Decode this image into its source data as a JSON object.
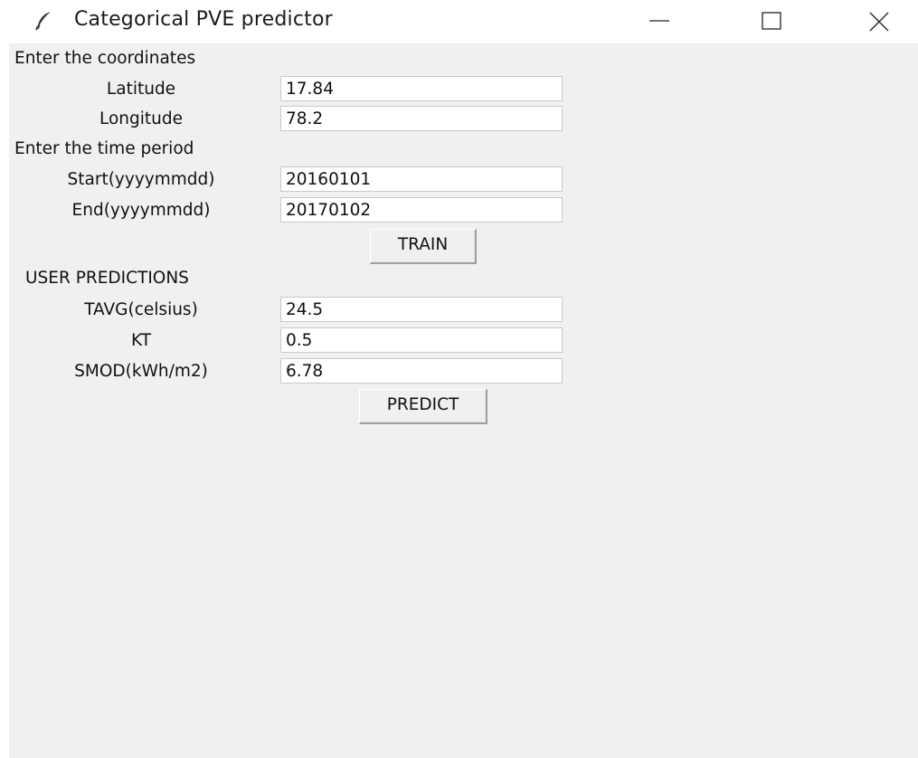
{
  "window": {
    "title": "Categorical PVE predictor",
    "icon": "feather-icon",
    "controls": [
      "minimize-icon",
      "maximize-icon",
      "close-icon"
    ]
  },
  "coordinates": {
    "heading": "Enter the coordinates",
    "latitude_label": "Latitude",
    "latitude_value": "17.84",
    "longitude_label": "Longitude",
    "longitude_value": "78.2"
  },
  "time_period": {
    "heading": "Enter the time period",
    "start_label": "Start(yyyymmdd)",
    "start_value": "20160101",
    "end_label": "End(yyyymmdd)",
    "end_value": "20170102"
  },
  "train_button": "TRAIN",
  "predictions": {
    "heading": "USER PREDICTIONS",
    "tavg_label": "TAVG(celsius)",
    "tavg_value": "24.5",
    "kt_label": "KT",
    "kt_value": "0.5",
    "smod_label": "SMOD(kWh/m2)",
    "smod_value": "6.78"
  },
  "predict_button": "PREDICT"
}
